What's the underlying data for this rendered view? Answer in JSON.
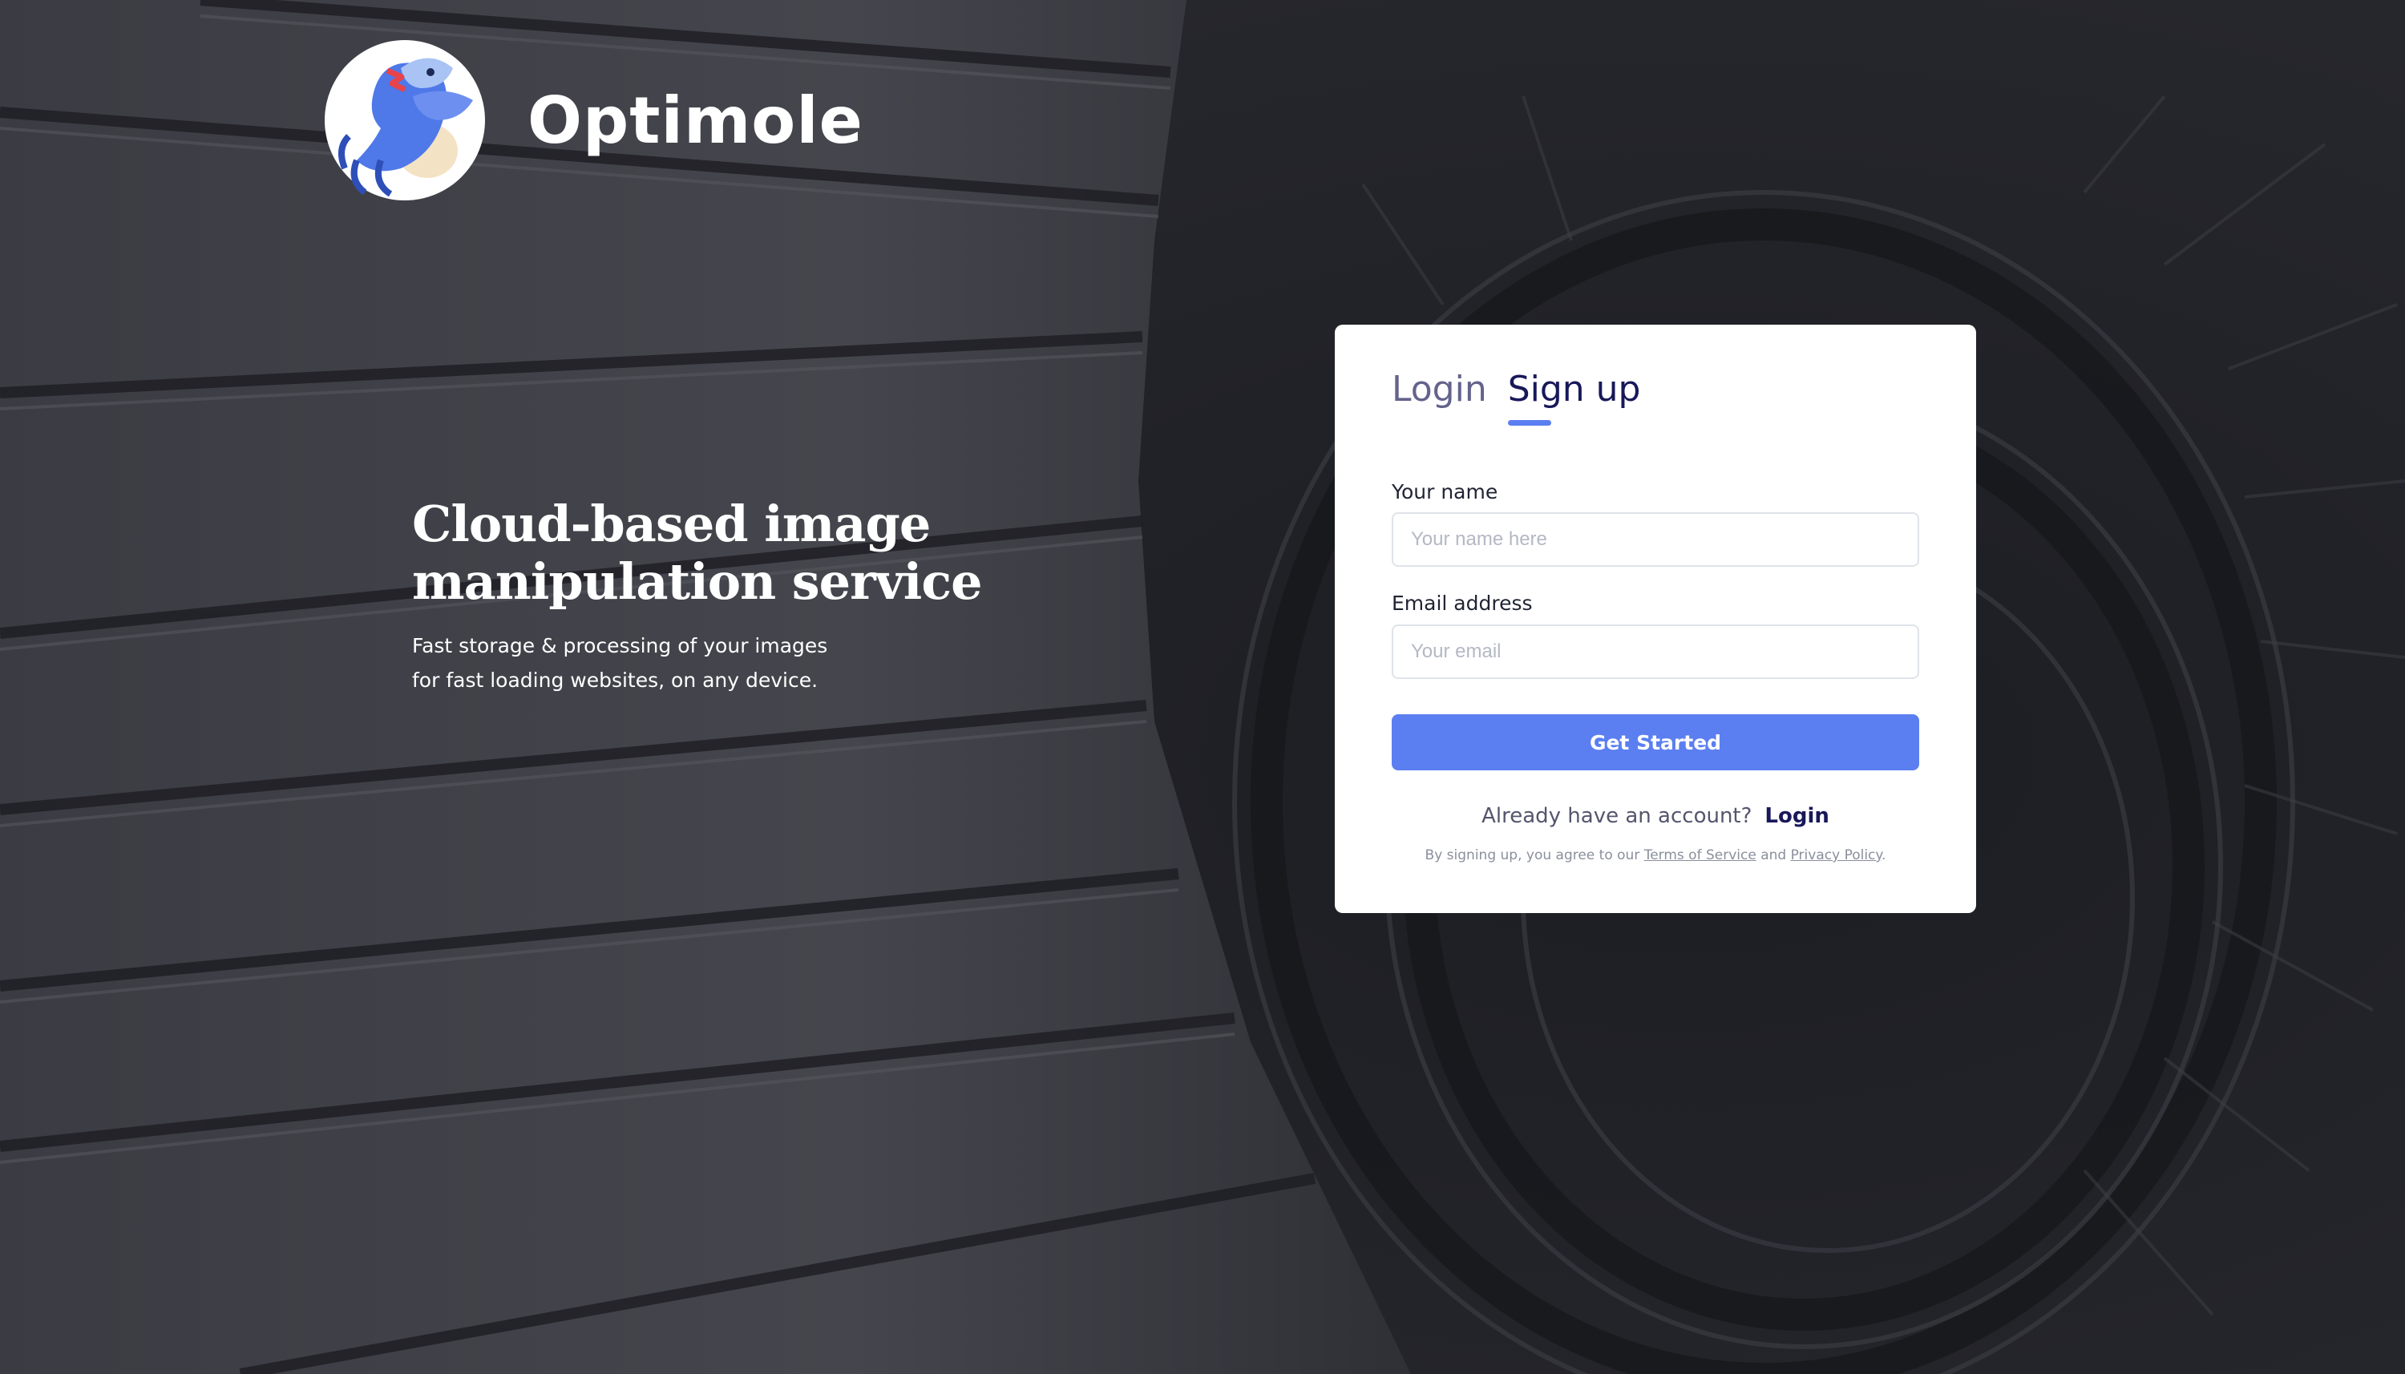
{
  "brand": {
    "name": "Optimole"
  },
  "hero": {
    "headline_line1": "Cloud-based image",
    "headline_line2": "manipulation service",
    "subtext_line1": "Fast storage & processing of your images",
    "subtext_line2": "for fast loading websites, on any device."
  },
  "auth_card": {
    "tabs": [
      {
        "label": "Login",
        "active": false
      },
      {
        "label": "Sign up",
        "active": true
      }
    ],
    "name_field": {
      "label": "Your name",
      "placeholder": "Your name here",
      "value": ""
    },
    "email_field": {
      "label": "Email address",
      "placeholder": "Your email",
      "value": ""
    },
    "submit_label": "Get Started",
    "already_text": "Already have an account?",
    "login_link": "Login",
    "terms_prefix": "By signing up, you agree to our",
    "terms_link": "Terms of Service",
    "terms_and": "and",
    "privacy_link": "Privacy Policy",
    "terms_suffix": "."
  },
  "colors": {
    "accent": "#5b7ff1",
    "tab_active": "#18185a",
    "tab_inactive": "#63638c",
    "background": "#2a2b31"
  },
  "icons": {
    "logo": "octopus-mascot-icon"
  }
}
